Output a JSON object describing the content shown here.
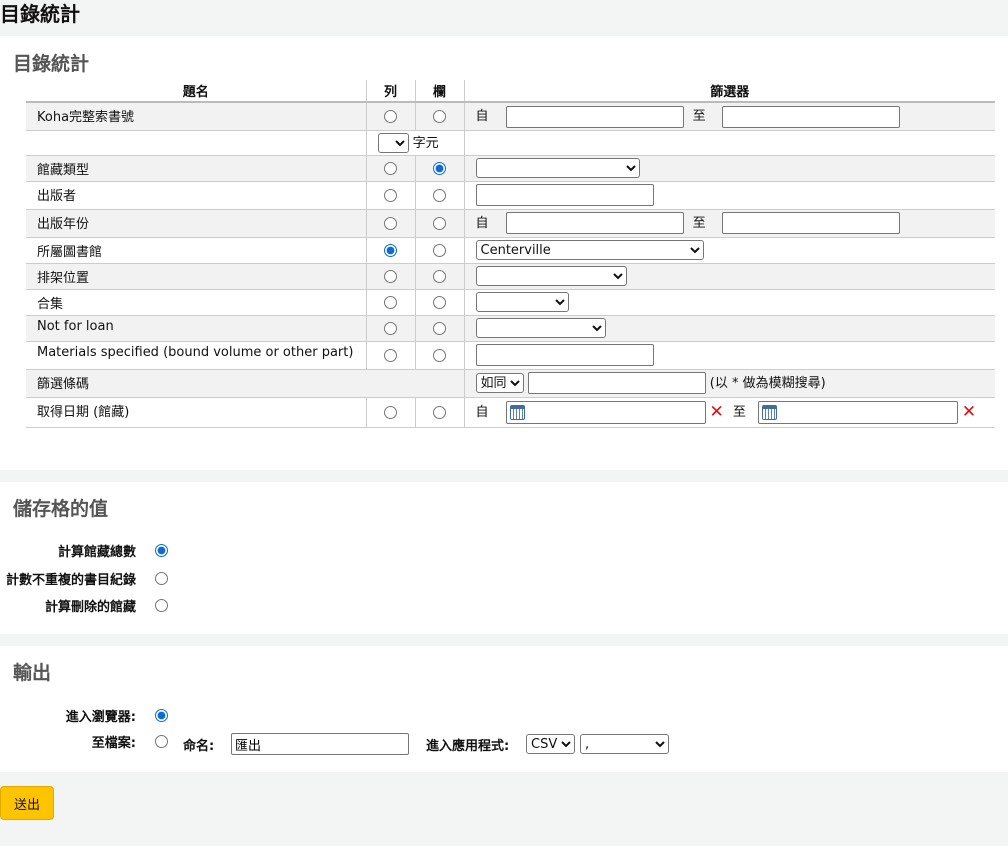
{
  "page_title": "目錄統計",
  "section_stats": {
    "title": "目錄統計",
    "headers": {
      "title": "題名",
      "row": "列",
      "col": "欄",
      "filter": "篩選器"
    },
    "from_label": "自",
    "to_label": "至",
    "char_label": "字元",
    "rows": {
      "callnumber": "Koha完整索書號",
      "itemtype": "館藏類型",
      "publisher": "出版者",
      "pubyear": "出版年份",
      "homebranch": "所屬圖書館",
      "location": "排架位置",
      "ccode": "合集",
      "notforloan": "Not for loan",
      "materials": "Materials specified (bound volume or other part)",
      "barcode": "篩選條碼",
      "acqdate": "取得日期 (館藏)"
    },
    "homebranch_value": "Centerville",
    "barcode_op": "如同",
    "barcode_hint": "(以 * 做為模糊搜尋)"
  },
  "section_cell": {
    "title": "儲存格的值",
    "options": [
      "計算館藏總數",
      "計數不重複的書目紀錄",
      "計算刪除的館藏"
    ]
  },
  "section_output": {
    "title": "輸出",
    "browser_label": "進入瀏覽器:",
    "file_label": "至檔案:",
    "name_label": "命名:",
    "name_value": "匯出",
    "app_label": "進入應用程式:",
    "format_value": "CSV",
    "delimiter_value": ","
  },
  "submit_label": "送出"
}
